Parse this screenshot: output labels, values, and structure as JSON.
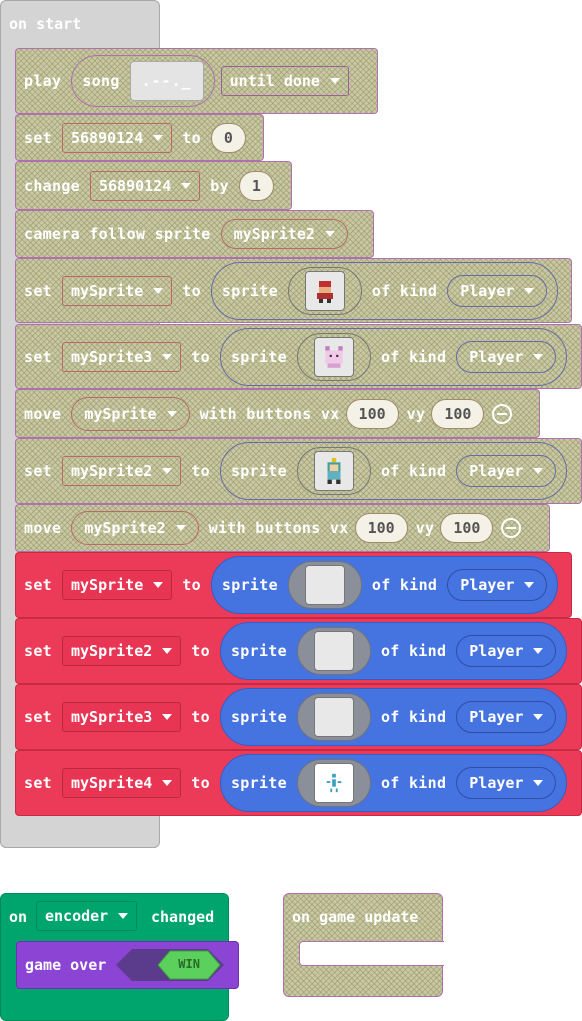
{
  "on_start": {
    "label": "on start",
    "blocks": {
      "play": {
        "play": "play",
        "song": "song",
        "song_preview": ".--._",
        "until": "until done"
      },
      "set_var": {
        "set": "set",
        "var": "56890124",
        "to": "to",
        "value": "0"
      },
      "change_var": {
        "change": "change",
        "var": "56890124",
        "by": "by",
        "value": "1"
      },
      "camera": {
        "label": "camera follow sprite",
        "sprite": "mySprite2"
      },
      "set_sprite_1": {
        "set": "set",
        "var": "mySprite",
        "to": "to",
        "sprite": "sprite",
        "of_kind": "of kind",
        "kind": "Player"
      },
      "set_sprite_3": {
        "set": "set",
        "var": "mySprite3",
        "to": "to",
        "sprite": "sprite",
        "of_kind": "of kind",
        "kind": "Player"
      },
      "move_1": {
        "move": "move",
        "var": "mySprite",
        "with": "with buttons vx",
        "vx": "100",
        "vy_label": "vy",
        "vy": "100"
      },
      "set_sprite_2": {
        "set": "set",
        "var": "mySprite2",
        "to": "to",
        "sprite": "sprite",
        "of_kind": "of kind",
        "kind": "Player"
      },
      "move_2": {
        "move": "move",
        "var": "mySprite2",
        "with": "with buttons vx",
        "vx": "100",
        "vy_label": "vy",
        "vy": "100"
      },
      "red_1": {
        "set": "set",
        "var": "mySprite",
        "to": "to",
        "sprite": "sprite",
        "of_kind": "of kind",
        "kind": "Player"
      },
      "red_2": {
        "set": "set",
        "var": "mySprite2",
        "to": "to",
        "sprite": "sprite",
        "of_kind": "of kind",
        "kind": "Player"
      },
      "red_3": {
        "set": "set",
        "var": "mySprite3",
        "to": "to",
        "sprite": "sprite",
        "of_kind": "of kind",
        "kind": "Player"
      },
      "red_4": {
        "set": "set",
        "var": "mySprite4",
        "to": "to",
        "sprite": "sprite",
        "of_kind": "of kind",
        "kind": "Player"
      }
    }
  },
  "on_encoder": {
    "on": "on",
    "encoder": "encoder",
    "changed": "changed",
    "game_over": "game over",
    "win": "WIN"
  },
  "on_game_update": {
    "label": "on game update"
  },
  "colors": {
    "red": "#ec3b58",
    "blue": "#4573e0",
    "green": "#00a56d",
    "purple": "#8c44d4",
    "disabled_hatch": "#c8c8a4"
  }
}
